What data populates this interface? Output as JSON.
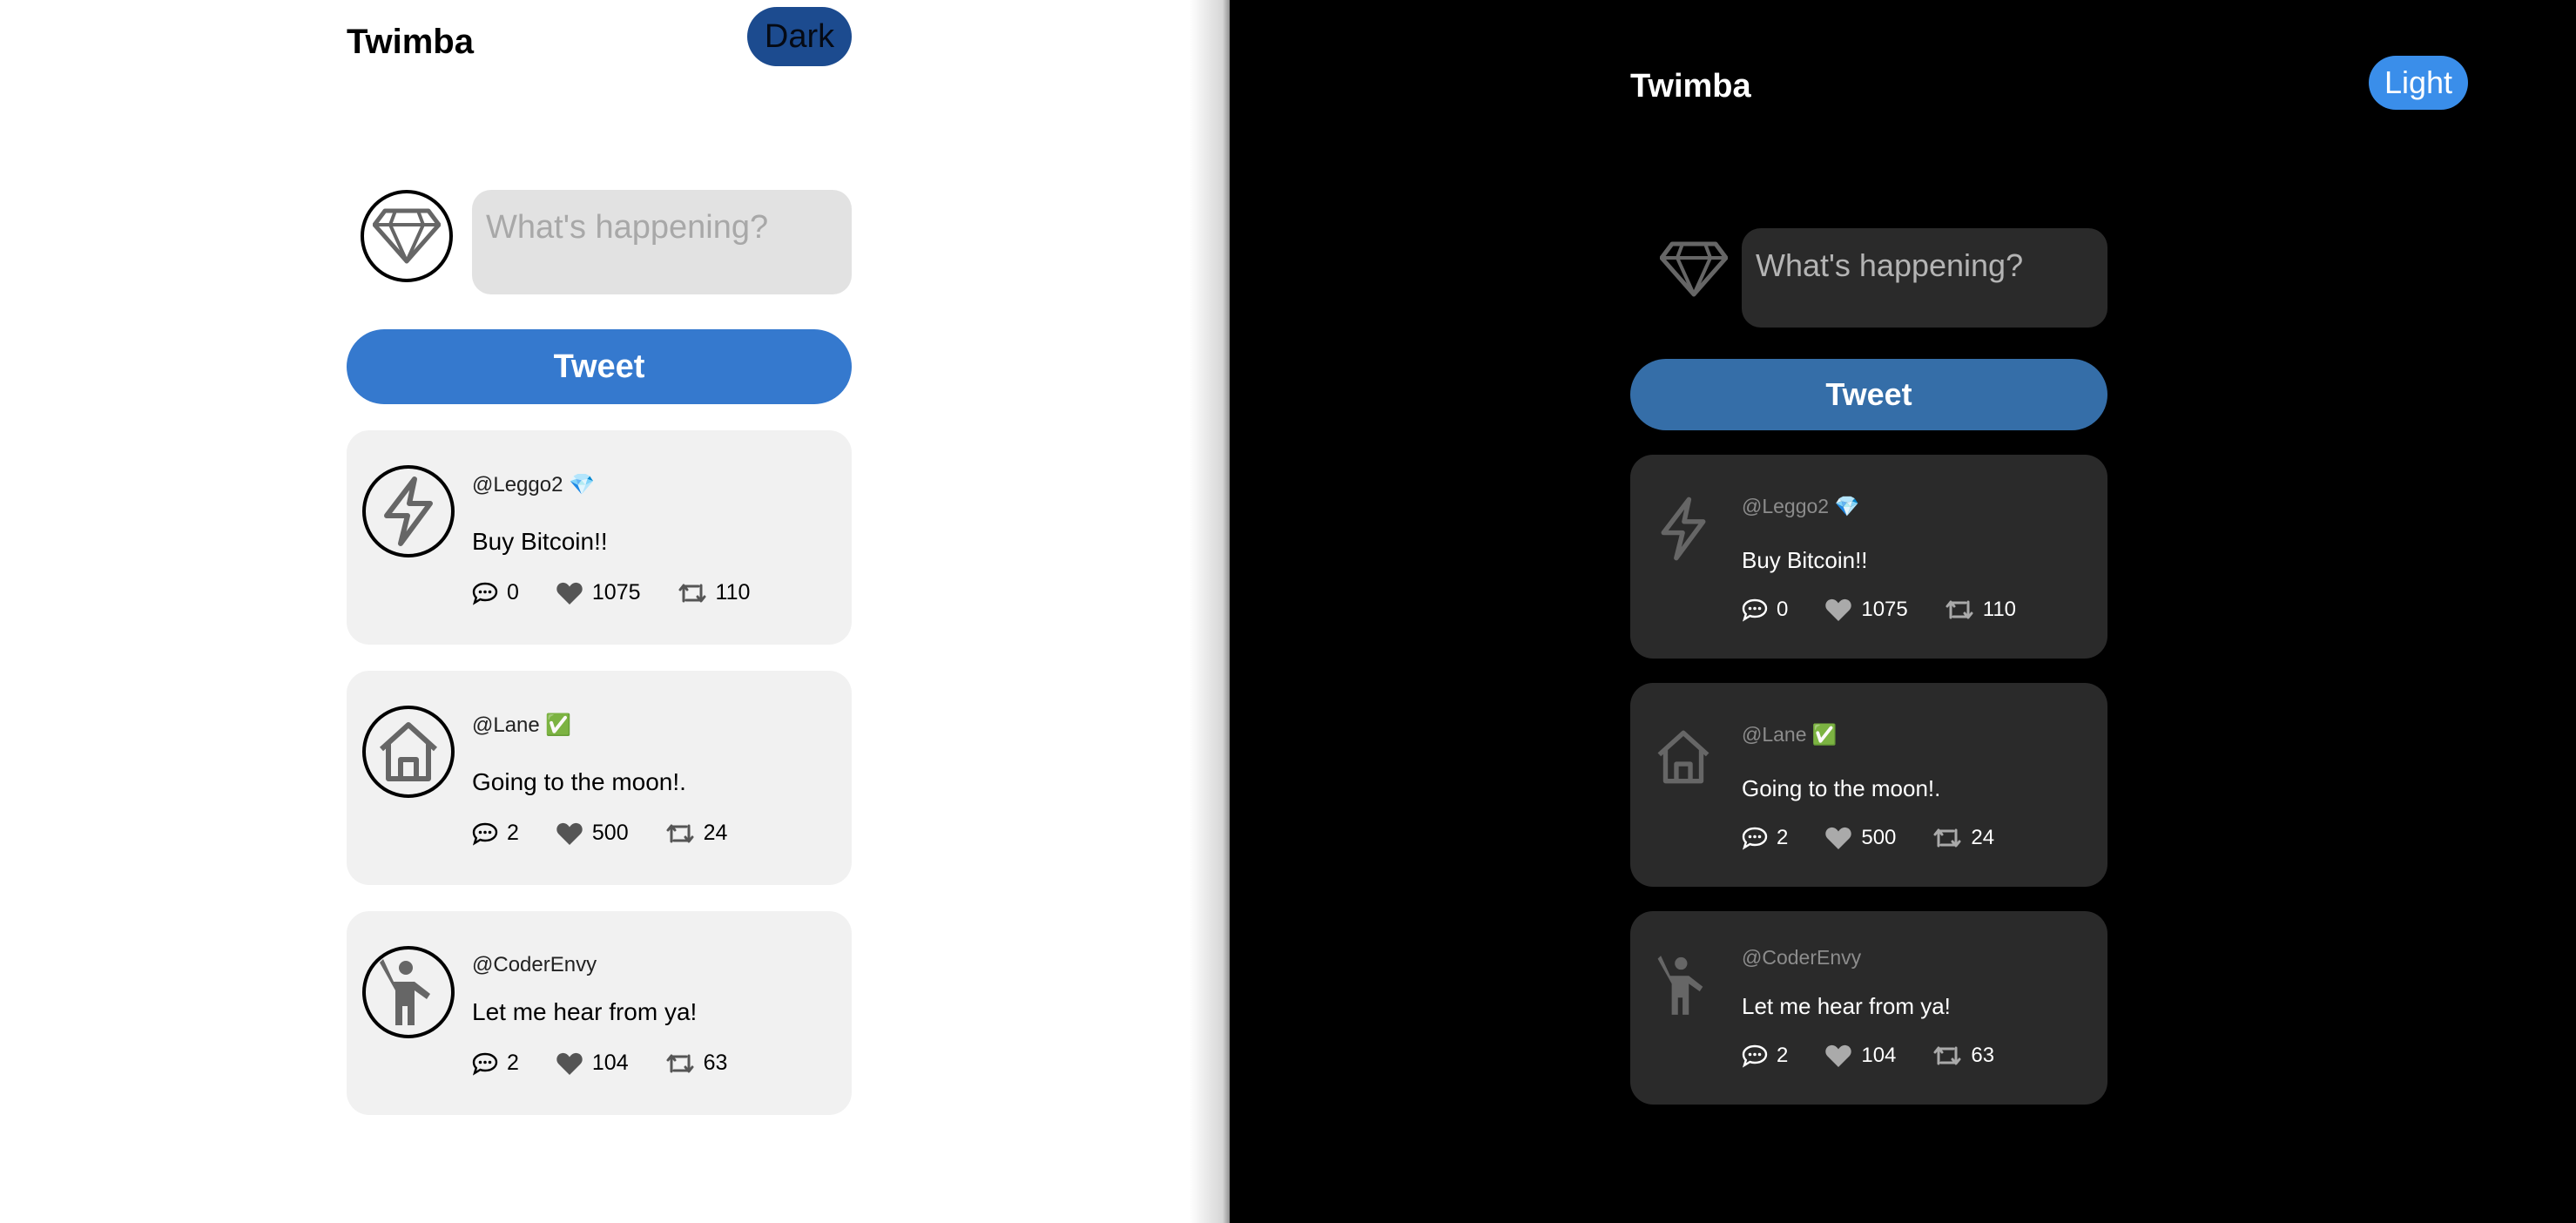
{
  "light": {
    "brand": "Twimba",
    "toggle_label": "Dark",
    "compose_placeholder": "What's happening?",
    "tweet_button": "Tweet",
    "tweets": [
      {
        "handle": "@Leggo2 💎",
        "text": "Buy Bitcoin!!",
        "replies": "0",
        "likes": "1075",
        "retweets": "110",
        "avatar_icon": "lightning-icon"
      },
      {
        "handle": "@Lane ✅",
        "text": "Going to the moon!.",
        "replies": "2",
        "likes": "500",
        "retweets": "24",
        "avatar_icon": "house-icon"
      },
      {
        "handle": "@CoderEnvy",
        "text": "Let me hear from ya!",
        "replies": "2",
        "likes": "104",
        "retweets": "63",
        "avatar_icon": "person-waving-icon"
      }
    ]
  },
  "dark": {
    "brand": "Twimba",
    "toggle_label": "Light",
    "compose_placeholder": "What's happening?",
    "tweet_button": "Tweet",
    "tweets": [
      {
        "handle": "@Leggo2 💎",
        "text": "Buy Bitcoin!!",
        "replies": "0",
        "likes": "1075",
        "retweets": "110",
        "avatar_icon": "lightning-icon"
      },
      {
        "handle": "@Lane ✅",
        "text": "Going to the moon!.",
        "replies": "2",
        "likes": "500",
        "retweets": "24",
        "avatar_icon": "house-icon"
      },
      {
        "handle": "@CoderEnvy",
        "text": "Let me hear from ya!",
        "replies": "2",
        "likes": "104",
        "retweets": "63",
        "avatar_icon": "person-waving-icon"
      }
    ]
  },
  "colors": {
    "light_accent": "#3579ce",
    "dark_accent": "#356ea8",
    "dark_toggle": "#1c4b8f",
    "light_toggle": "#3a8eea"
  }
}
